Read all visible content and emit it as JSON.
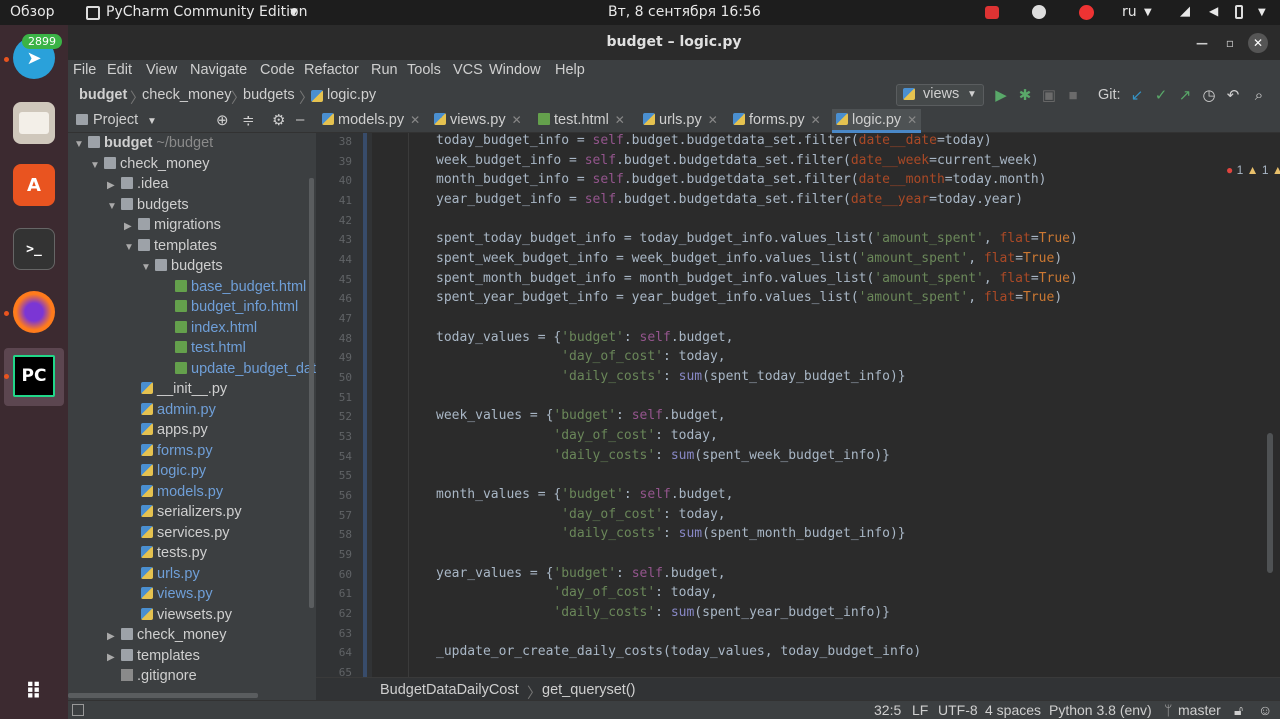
{
  "topbar": {
    "activities": "Обзор",
    "app_name": "PyCharm Community Edition",
    "clock": "Вт, 8 сентября  16:56",
    "lang": "ru"
  },
  "dock": {
    "telegram_badge": "2899",
    "pycharm_label": "PC",
    "terminal_label": ">_"
  },
  "window": {
    "title": "budget – logic.py"
  },
  "menu": [
    "File",
    "Edit",
    "View",
    "Navigate",
    "Code",
    "Refactor",
    "Run",
    "Tools",
    "VCS",
    "Window",
    "Help"
  ],
  "nav": {
    "crumbs": [
      "budget",
      "check_money",
      "budgets",
      "logic.py"
    ],
    "run_config": "views",
    "git_label": "Git:"
  },
  "project": {
    "header": "Project",
    "root_name": "budget",
    "root_path": "~/budget",
    "items": [
      "check_money",
      ".idea",
      "budgets",
      "migrations",
      "templates",
      "budgets",
      "base_budget.html",
      "budget_info.html",
      "index.html",
      "test.html",
      "update_budget_dat",
      "__init__.py",
      "admin.py",
      "apps.py",
      "forms.py",
      "logic.py",
      "models.py",
      "serializers.py",
      "services.py",
      "tests.py",
      "urls.py",
      "views.py",
      "viewsets.py",
      "check_money",
      "templates",
      ".gitignore"
    ]
  },
  "tabs": [
    "models.py",
    "views.py",
    "test.html",
    "urls.py",
    "forms.py",
    "logic.py"
  ],
  "inspections": {
    "errors": "1",
    "warnings": "1",
    "weak": "4"
  },
  "gutter": [
    "38",
    "39",
    "40",
    "41",
    "42",
    "43",
    "44",
    "45",
    "46",
    "47",
    "48",
    "49",
    "50",
    "51",
    "52",
    "53",
    "54",
    "55",
    "56",
    "57",
    "58",
    "59",
    "60",
    "61",
    "62",
    "63",
    "64",
    "65"
  ],
  "breadcrumb": {
    "class_name": "BudgetDataDailyCost",
    "method_name": "get_queryset()"
  },
  "status": {
    "position": "32:5",
    "line_sep": "LF",
    "encoding": "UTF-8",
    "indent": "4 spaces",
    "interpreter": "Python 3.8 (env)",
    "branch": "master"
  }
}
